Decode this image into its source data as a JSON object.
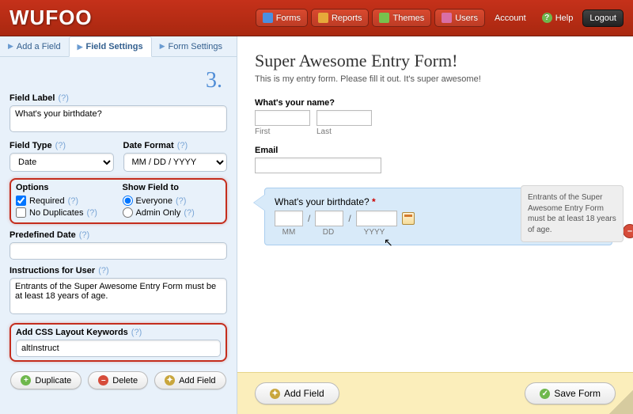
{
  "brand": "WUFOO",
  "nav": {
    "forms": "Forms",
    "reports": "Reports",
    "themes": "Themes",
    "users": "Users",
    "account": "Account",
    "help": "Help",
    "logout": "Logout"
  },
  "tabs": {
    "add": "Add a Field",
    "settings": "Field Settings",
    "form": "Form Settings"
  },
  "step": "3.",
  "settings": {
    "field_label_hdr": "Field Label",
    "field_label_val": "What's your birthdate?",
    "field_type_hdr": "Field Type",
    "field_type_val": "Date",
    "date_format_hdr": "Date Format",
    "date_format_val": "MM / DD / YYYY",
    "options_hdr": "Options",
    "opt_required": "Required",
    "opt_nodup": "No Duplicates",
    "show_hdr": "Show Field to",
    "show_everyone": "Everyone",
    "show_admin": "Admin Only",
    "predef_hdr": "Predefined Date",
    "predef_val": "",
    "instr_hdr": "Instructions for User",
    "instr_val": "Entrants of the Super Awesome Entry Form must be at least 18 years of age.",
    "css_hdr": "Add CSS Layout Keywords",
    "css_val": "altInstruct",
    "help": "(?)"
  },
  "side_buttons": {
    "duplicate": "Duplicate",
    "delete": "Delete",
    "addfield": "Add Field"
  },
  "form": {
    "title": "Super Awesome Entry Form!",
    "desc": "This is my entry form. Please fill it out. It's super awesome!",
    "name_label": "What's your name?",
    "first": "First",
    "last": "Last",
    "email_label": "Email",
    "bd_label": "What's your birthdate?",
    "mm": "MM",
    "dd": "DD",
    "yyyy": "YYYY",
    "slash": "/"
  },
  "info_text": "Entrants of the Super Awesome Entry Form must be at least 18 years of age.",
  "footer": {
    "add": "Add Field",
    "save": "Save Form"
  }
}
